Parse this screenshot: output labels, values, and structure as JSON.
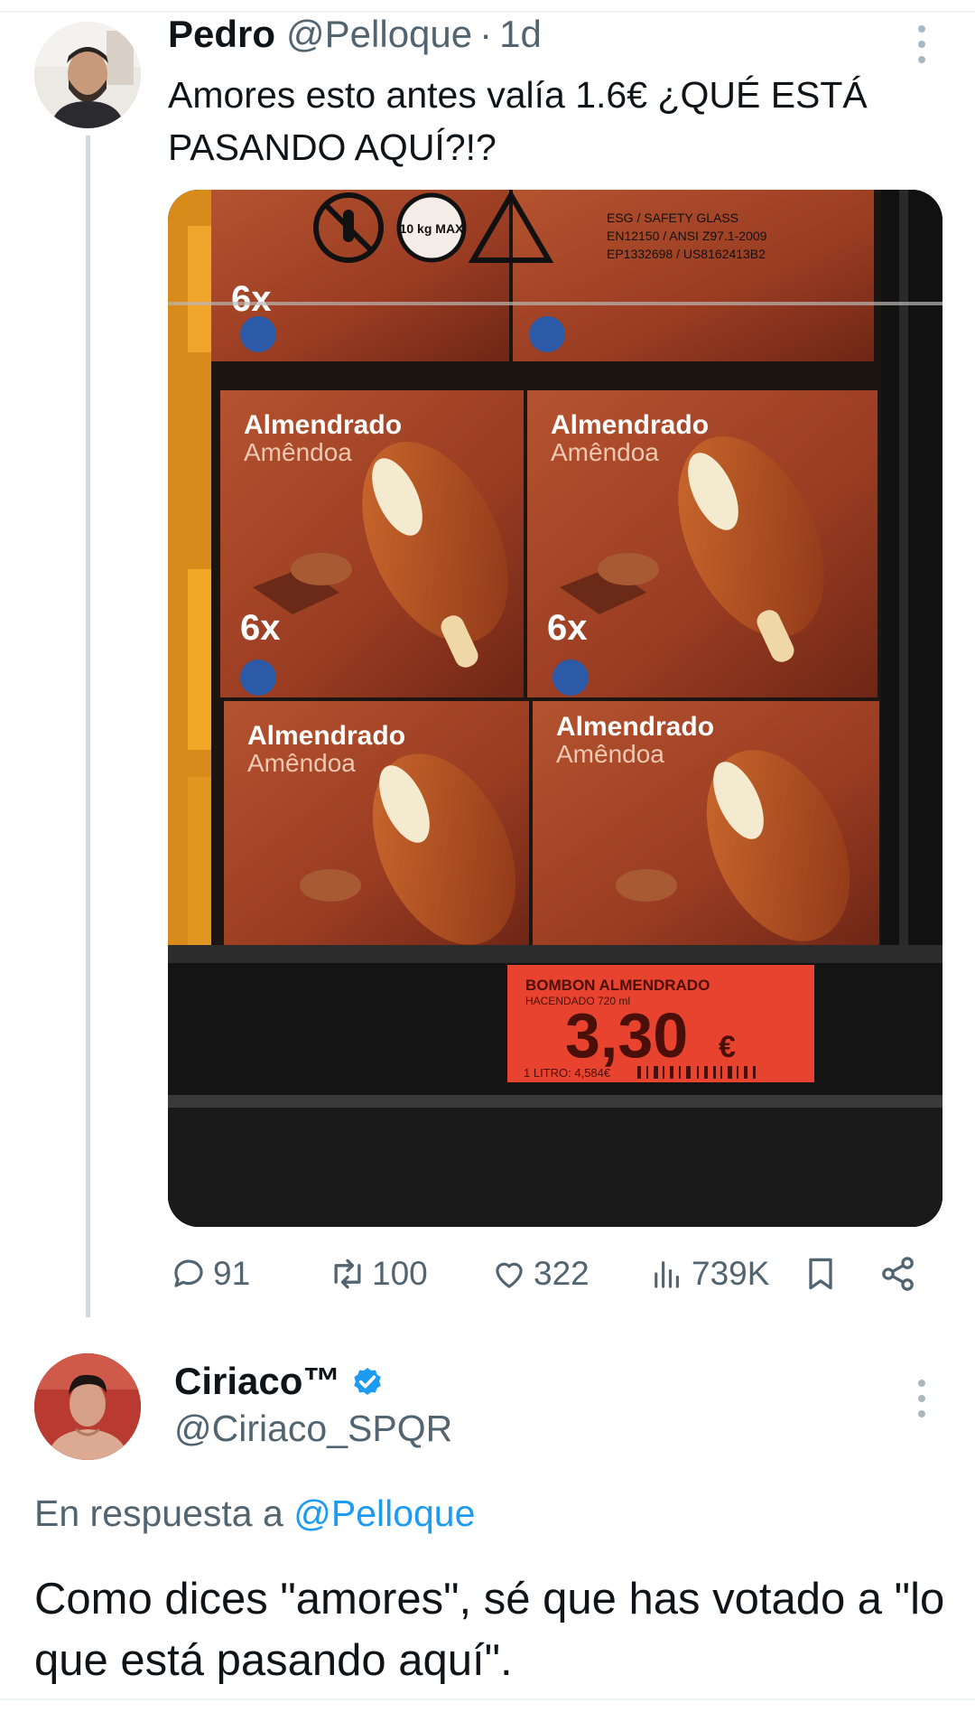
{
  "tweet1": {
    "display_name": "Pedro",
    "handle": "@Pelloque",
    "separator": "·",
    "time": "1d",
    "text": "Amores esto antes valía 1.6€ ¿QUÉ ESTÁ PASANDO AQUÍ?!?",
    "photo": {
      "warning_badge": "10 kg MAX",
      "glass_label_line1": "ESG / SAFETY GLASS",
      "glass_label_line2": "EN12150 / ANSI Z97.1-2009",
      "glass_label_line3": "EP1332698 / US8162413B2",
      "box_name": "Almendrado",
      "box_subname": "Amêndoa",
      "box_count": "6x",
      "price_tag_product": "BOMBON ALMENDRADO",
      "price_tag_brand": "HACENDADO 720 ml",
      "price_tag_price": "3,30",
      "price_tag_currency": "€",
      "price_tag_unit_price": "1 LITRO: 4,584€"
    },
    "stats": {
      "replies": "91",
      "retweets": "100",
      "likes": "322",
      "views": "739K"
    }
  },
  "tweet2": {
    "display_name": "Ciriaco™",
    "verified": true,
    "handle": "@Ciriaco_SPQR",
    "reply_prefix": "En respuesta a",
    "reply_to": "@Pelloque",
    "text": "Como dices \"amores\", sé que has votado a \"lo que está pasando aquí\"."
  },
  "colors": {
    "text_primary": "#0f1419",
    "text_secondary": "#536471",
    "link": "#1d9bf0",
    "divider": "#eff3f4",
    "price_tag": "#e8432f"
  },
  "icons": [
    "reply-icon",
    "retweet-icon",
    "like-icon",
    "views-icon",
    "bookmark-icon",
    "share-icon",
    "more-icon",
    "verified-badge-icon"
  ]
}
